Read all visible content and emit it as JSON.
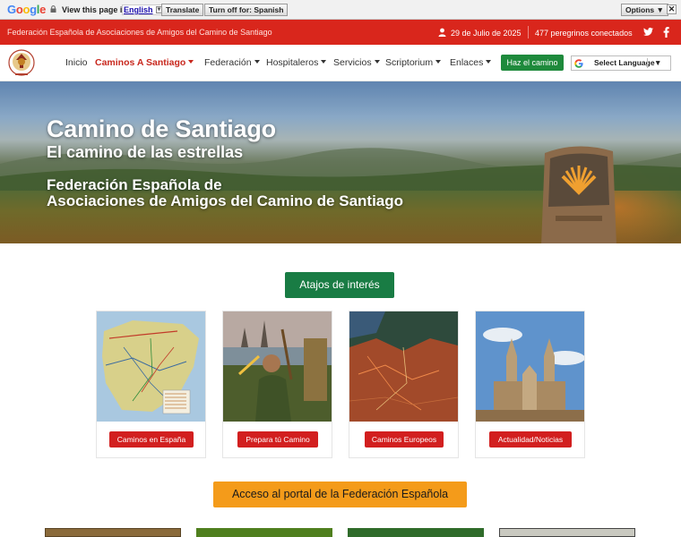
{
  "translate_bar": {
    "logo": "Google",
    "view_text": "View this page in:",
    "language": "English",
    "translate_label": "Translate",
    "turn_off_label": "Turn off for: Spanish",
    "options_label": "Options ▼",
    "close_label": "✕"
  },
  "topbar": {
    "federation_name": "Federación Española de Asociaciones de Amigos del Camino de Santiago",
    "date": "29 de Julio de 2025",
    "online": "477 peregrinos conectados"
  },
  "nav": {
    "items": [
      {
        "label": "Inicio"
      },
      {
        "label": "Caminos A Santiago"
      },
      {
        "label": "Federación"
      },
      {
        "label": "Hospitaleros"
      },
      {
        "label": "Servicios"
      },
      {
        "label": "Scriptorium"
      },
      {
        "label": "Enlaces"
      }
    ],
    "cta_label": "Haz el camino",
    "language_select": "Select Language",
    "language_arrow": "▼"
  },
  "hero": {
    "title": "Camino de Santiago",
    "subtitle": "El camino de las estrellas",
    "org_line1": "Federación Española de",
    "org_line2": "Asociaciones de Amigos del Camino de Santiago"
  },
  "shortcuts": {
    "heading": "Atajos de interés",
    "cards": [
      {
        "label": "Caminos en España"
      },
      {
        "label": "Prepara tú Camino"
      },
      {
        "label": "Caminos Europeos"
      },
      {
        "label": "Actualidad/Noticias"
      }
    ]
  },
  "portal_button": "Acceso al portal de la Federación Española",
  "colors": {
    "topbar_red": "#d9261c",
    "active_nav": "#c8281e",
    "green": "#197c44",
    "card_button_red": "#d21f1f",
    "portal_orange": "#f49b1a"
  }
}
